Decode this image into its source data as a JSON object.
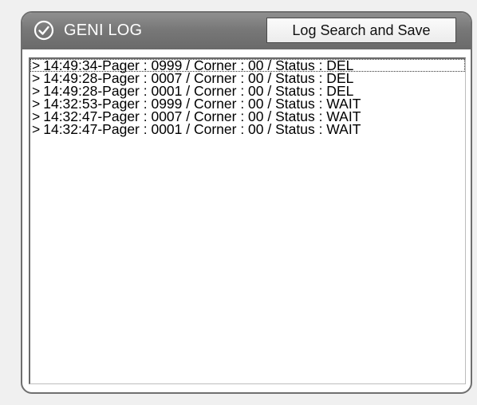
{
  "panel": {
    "title": "GENI LOG",
    "icon": "check-circle-icon",
    "button_label": "Log Search and Save"
  },
  "log_entries": [
    {
      "arrow": ">",
      "text": "14:49:34-Pager : 0999 / Corner : 00 / Status : DEL",
      "selected": true
    },
    {
      "arrow": ">",
      "text": "14:49:28-Pager : 0007 / Corner : 00 / Status : DEL",
      "selected": false
    },
    {
      "arrow": ">",
      "text": "14:49:28-Pager : 0001 / Corner : 00 / Status : DEL",
      "selected": false
    },
    {
      "arrow": ">",
      "text": "14:32:53-Pager : 0999 / Corner : 00 / Status : WAIT",
      "selected": false
    },
    {
      "arrow": ">",
      "text": "14:32:47-Pager : 0007 / Corner : 00 / Status : WAIT",
      "selected": false
    },
    {
      "arrow": ">",
      "text": "14:32:47-Pager : 0001 / Corner : 00 / Status : WAIT",
      "selected": false
    }
  ],
  "colors": {
    "header": "#787878",
    "panel_border": "#6f6f6f",
    "list_background": "#ffffff"
  }
}
